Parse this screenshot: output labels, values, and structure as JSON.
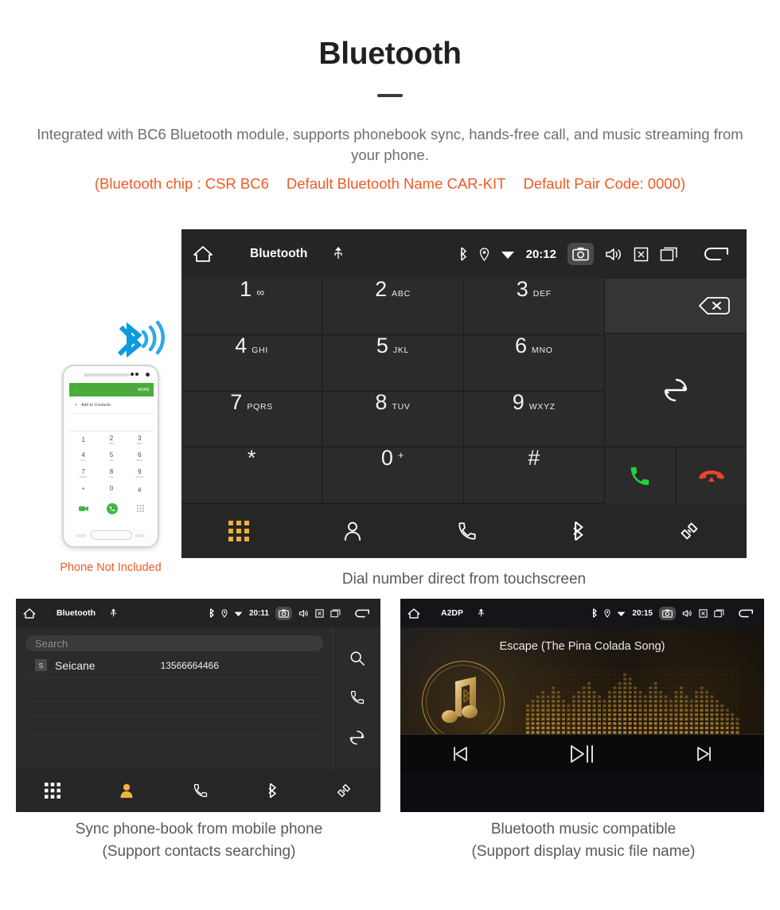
{
  "hero": {
    "title": "Bluetooth",
    "description": "Integrated with BC6 Bluetooth module, supports phonebook sync, hands-free call, and music streaming from your phone.",
    "spec_1": "(Bluetooth chip : CSR BC6",
    "spec_2": "Default Bluetooth Name CAR-KIT",
    "spec_3": "Default Pair Code: 0000)",
    "accent_color": "#f15a24",
    "body_color": "#6d6e71"
  },
  "dialer": {
    "statusbar": {
      "home_icon": "home-icon",
      "title": "Bluetooth",
      "usb_icon": "usb-icon",
      "bluetooth_icon": "bluetooth-icon",
      "location_icon": "location-icon",
      "wifi_icon": "wifi-icon",
      "time": "20:12",
      "camera_icon": "camera-icon",
      "volume_icon": "volume-icon",
      "close_icon": "close-box-icon",
      "recents_icon": "recent-apps-icon",
      "back_icon": "back-arrow-icon"
    },
    "keys": [
      {
        "num": "1",
        "sub": "∞",
        "name": "key-1",
        "voicemail": true
      },
      {
        "num": "2",
        "sub": "ABC",
        "name": "key-2"
      },
      {
        "num": "3",
        "sub": "DEF",
        "name": "key-3"
      },
      {
        "num": "4",
        "sub": "GHI",
        "name": "key-4"
      },
      {
        "num": "5",
        "sub": "JKL",
        "name": "key-5"
      },
      {
        "num": "6",
        "sub": "MNO",
        "name": "key-6"
      },
      {
        "num": "7",
        "sub": "PQRS",
        "name": "key-7"
      },
      {
        "num": "8",
        "sub": "TUV",
        "name": "key-8"
      },
      {
        "num": "9",
        "sub": "WXYZ",
        "name": "key-9"
      },
      {
        "num": "*",
        "sub": "",
        "name": "key-star"
      },
      {
        "num": "0",
        "sub": "+",
        "name": "key-0",
        "superscript": true
      },
      {
        "num": "#",
        "sub": "",
        "name": "key-hash"
      }
    ],
    "number_display": "",
    "backspace_icon": "backspace-icon",
    "redial_icon": "sync-redial-icon",
    "call_icon": "call-green-icon",
    "hangup_icon": "hangup-red-icon",
    "nav": [
      {
        "name": "nav-keypad",
        "icon": "keypad-icon",
        "active": true
      },
      {
        "name": "nav-contacts",
        "icon": "contact-person-icon",
        "active": false
      },
      {
        "name": "nav-call-log",
        "icon": "phone-handset-icon",
        "active": false
      },
      {
        "name": "nav-bluetooth",
        "icon": "bluetooth-icon",
        "active": false
      },
      {
        "name": "nav-link",
        "icon": "link-chain-icon",
        "active": false
      }
    ],
    "caption": "Dial number direct from touchscreen",
    "active_color": "#f2b33d"
  },
  "phone_mockup": {
    "bluetooth_icon": "bluetooth-wave-icon",
    "bluetooth_color": "#0e9ae0",
    "header_more": "MORE",
    "header_back": "back-arrow-icon",
    "add_contacts": "Add to Contacts",
    "keys": [
      {
        "num": "1",
        "sub": ""
      },
      {
        "num": "2",
        "sub": "ABC"
      },
      {
        "num": "3",
        "sub": "DEF"
      },
      {
        "num": "4",
        "sub": "GHI"
      },
      {
        "num": "5",
        "sub": "JKL"
      },
      {
        "num": "6",
        "sub": "MNO"
      },
      {
        "num": "7",
        "sub": "PQRS"
      },
      {
        "num": "8",
        "sub": "TUV"
      },
      {
        "num": "9",
        "sub": "WXYZ"
      },
      {
        "num": "*",
        "sub": ""
      },
      {
        "num": "0",
        "sub": "+"
      },
      {
        "num": "#",
        "sub": ""
      }
    ],
    "note": "Phone Not Included",
    "note_color": "#f15a24"
  },
  "contacts": {
    "statusbar": {
      "title": "Bluetooth",
      "time": "20:11"
    },
    "search_placeholder": "Search",
    "rows": [
      {
        "badge": "S",
        "name": "Seicane",
        "number": "13566664466"
      }
    ],
    "side_icons": [
      {
        "name": "search-icon"
      },
      {
        "name": "phone-handset-icon"
      },
      {
        "name": "sync-icon"
      }
    ],
    "nav": [
      {
        "name": "nav-keypad",
        "icon": "keypad-icon",
        "active": false
      },
      {
        "name": "nav-contacts",
        "icon": "contact-person-icon",
        "active": true
      },
      {
        "name": "nav-call-log",
        "icon": "phone-handset-icon",
        "active": false
      },
      {
        "name": "nav-bluetooth",
        "icon": "bluetooth-icon",
        "active": false
      },
      {
        "name": "nav-link",
        "icon": "link-chain-icon",
        "active": false
      }
    ],
    "caption_line1": "Sync phone-book from mobile phone",
    "caption_line2": "(Support contacts searching)"
  },
  "music": {
    "statusbar": {
      "title": "A2DP",
      "time": "20:15"
    },
    "track_title": "Escape (The Pina Colada Song)",
    "album_art_icon": "music-note-bluetooth-icon",
    "visualizer": "dot-matrix-equalizer",
    "controls": [
      {
        "name": "previous-track-button",
        "icon": "skip-previous-icon"
      },
      {
        "name": "play-pause-button",
        "icon": "play-pause-icon"
      },
      {
        "name": "next-track-button",
        "icon": "skip-next-icon"
      }
    ],
    "gold_color": "#c9a24a",
    "caption_line1": "Bluetooth music compatible",
    "caption_line2": "(Support display music file name)"
  }
}
